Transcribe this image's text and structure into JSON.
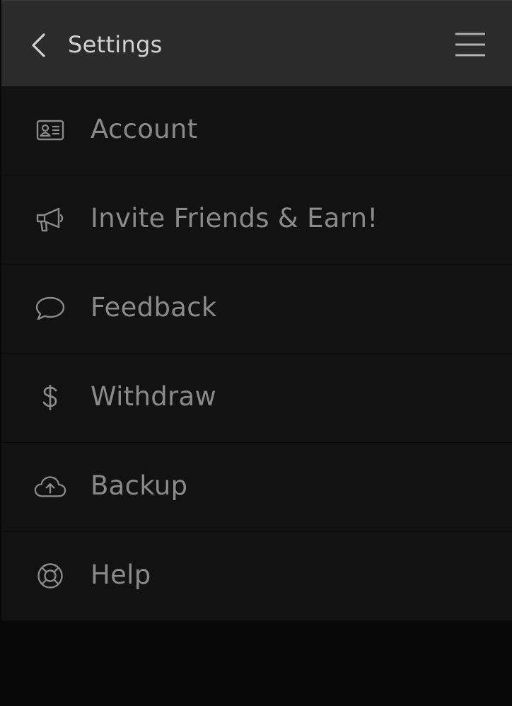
{
  "header": {
    "title": "Settings",
    "back_icon": "chevron-left-icon",
    "menu_icon": "hamburger-menu-icon"
  },
  "menu": {
    "items": [
      {
        "label": "Account",
        "icon": "id-card-icon"
      },
      {
        "label": "Invite Friends & Earn!",
        "icon": "megaphone-icon"
      },
      {
        "label": "Feedback",
        "icon": "speech-bubble-icon"
      },
      {
        "label": "Withdraw",
        "icon": "dollar-sign-icon"
      },
      {
        "label": "Backup",
        "icon": "cloud-upload-icon"
      },
      {
        "label": "Help",
        "icon": "lifebuoy-icon"
      }
    ]
  },
  "colors": {
    "background": "#080808",
    "header_bg": "#2b2b2b",
    "item_bg": "#121212",
    "header_text": "#d2d2d2",
    "item_text": "#8a8a8a",
    "icon": "#8a8a8a"
  }
}
